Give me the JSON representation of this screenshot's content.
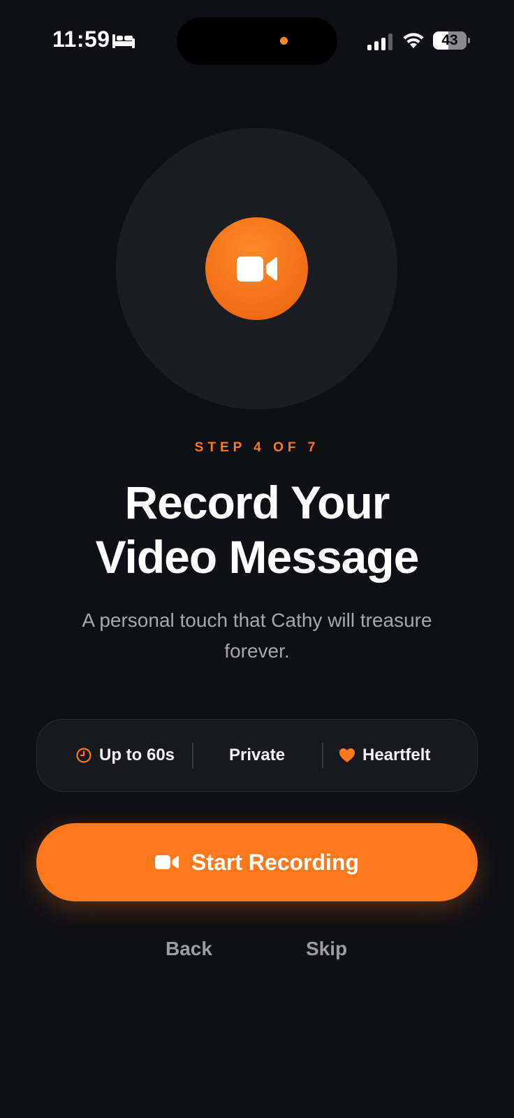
{
  "status_bar": {
    "time": "11:59",
    "battery_level": "43",
    "focus_icon": "bed-icon",
    "signal_icon": "cellular-signal-icon",
    "wifi_icon": "wifi-icon",
    "recording_dot_color": "#ff8a2a"
  },
  "hero": {
    "icon": "video-camera-icon",
    "accent_color": "#ff781b"
  },
  "step": {
    "label": "STEP 4 OF 7"
  },
  "title": {
    "line1": "Record Your",
    "line2": "Video Message"
  },
  "subtitle": "A personal touch that Cathy will treasure forever.",
  "features": [
    {
      "icon": "clock-icon",
      "label": "Up to 60s"
    },
    {
      "icon": "",
      "label": "Private"
    },
    {
      "icon": "heart-icon",
      "label": "Heartfelt"
    }
  ],
  "actions": {
    "start_label": "Start Recording",
    "start_icon": "video-camera-icon",
    "back_label": "Back",
    "skip_label": "Skip"
  }
}
